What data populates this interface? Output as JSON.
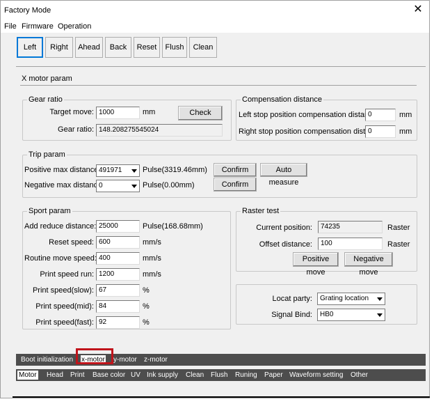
{
  "window": {
    "title": "Factory Mode",
    "close_glyph": "✕"
  },
  "menu": [
    "File",
    "Firmware",
    "Operation"
  ],
  "toolbar": [
    "Left",
    "Right",
    "Ahead",
    "Back",
    "Reset",
    "Flush",
    "Clean"
  ],
  "panel_title": "X motor param",
  "gear_ratio": {
    "legend": "Gear ratio",
    "target_move_label": "Target move:",
    "target_move_value": "1000",
    "target_move_unit": "mm",
    "check_label": "Check",
    "gear_ratio_label": "Gear ratio:",
    "gear_ratio_value": "148.208275545024"
  },
  "compensation": {
    "legend": "Compensation distance",
    "left_label": "Left stop position compensation distance:",
    "left_value": "0",
    "left_unit": "mm",
    "right_label": "Right stop position compensation distance:",
    "right_value": "0",
    "right_unit": "mm"
  },
  "trip": {
    "legend": "Trip param",
    "pos_label": "Positive max distance:",
    "pos_value": "491971",
    "pos_pulse": "Pulse(3319.46mm)",
    "neg_label": "Negative max distance:",
    "neg_value": "0",
    "neg_pulse": "Pulse(0.00mm)",
    "confirm_label": "Confirm",
    "auto_measure_label": "Auto measure"
  },
  "sport": {
    "legend": "Sport param",
    "rows": [
      {
        "label": "Add reduce distance:",
        "value": "25000",
        "unit": "Pulse(168.68mm)"
      },
      {
        "label": "Reset speed:",
        "value": "600",
        "unit": "mm/s"
      },
      {
        "label": "Routine move speed:",
        "value": "400",
        "unit": "mm/s"
      },
      {
        "label": "Print speed run:",
        "value": "1200",
        "unit": "mm/s"
      },
      {
        "label": "Print speed(slow):",
        "value": "67",
        "unit": "%"
      },
      {
        "label": "Print speed(mid):",
        "value": "84",
        "unit": "%"
      },
      {
        "label": "Print speed(fast):",
        "value": "92",
        "unit": "%"
      }
    ]
  },
  "raster": {
    "legend": "Raster test",
    "current_label": "Current position:",
    "current_value": "74235",
    "current_unit": "Raster",
    "offset_label": "Offset distance:",
    "offset_value": "100",
    "offset_unit": "Raster",
    "positive_label": "Positive move",
    "negative_label": "Negative move"
  },
  "locate": {
    "party_label": "Locat party:",
    "party_value": "Grating location",
    "signal_label": "Signal Bind:",
    "signal_value": "HB0"
  },
  "subtabs": [
    "Boot initialization",
    "x-motor",
    "y-motor",
    "z-motor"
  ],
  "maintabs": [
    "Motor",
    "Head",
    "Print",
    "Base color",
    "UV",
    "Ink supply",
    "Clean",
    "Flush",
    "Runing",
    "Paper",
    "Waveform setting",
    "Other"
  ]
}
